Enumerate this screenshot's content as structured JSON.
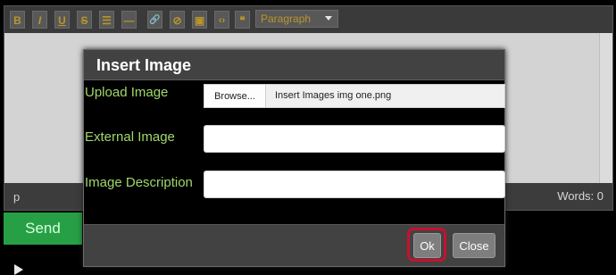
{
  "toolbar": {
    "buttons": [
      {
        "icon": "bold-icon",
        "glyph": "B"
      },
      {
        "icon": "italic-icon",
        "glyph": "I"
      },
      {
        "icon": "underline-icon",
        "glyph": "U"
      },
      {
        "icon": "strikethrough-icon",
        "glyph": "S"
      },
      {
        "icon": "list-icon",
        "glyph": "☰"
      },
      {
        "icon": "horizontal-rule-icon",
        "glyph": "—"
      },
      {
        "icon": "link-icon",
        "glyph": "🔗"
      },
      {
        "icon": "unlink-icon",
        "glyph": "⊘"
      },
      {
        "icon": "image-icon",
        "glyph": "▣"
      },
      {
        "icon": "code-icon",
        "glyph": "‹›"
      },
      {
        "icon": "quote-icon",
        "glyph": "❝"
      }
    ],
    "format_select": "Paragraph"
  },
  "editor": {
    "path": "p",
    "word_count": "Words: 0"
  },
  "send_label": "Send",
  "modal": {
    "title": "Insert Image",
    "upload_label": "Upload Image",
    "browse_label": "Browse...",
    "file_name": "Insert Images img one.png",
    "external_label": "External Image",
    "external_value": "",
    "description_label": "Image Description",
    "description_value": "",
    "ok_label": "Ok",
    "close_label": "Close"
  },
  "colors": {
    "label_green": "#9fd86a",
    "send_green": "#27a045",
    "highlight_red": "#c8102e",
    "toolbar_gold": "#b8952c"
  }
}
